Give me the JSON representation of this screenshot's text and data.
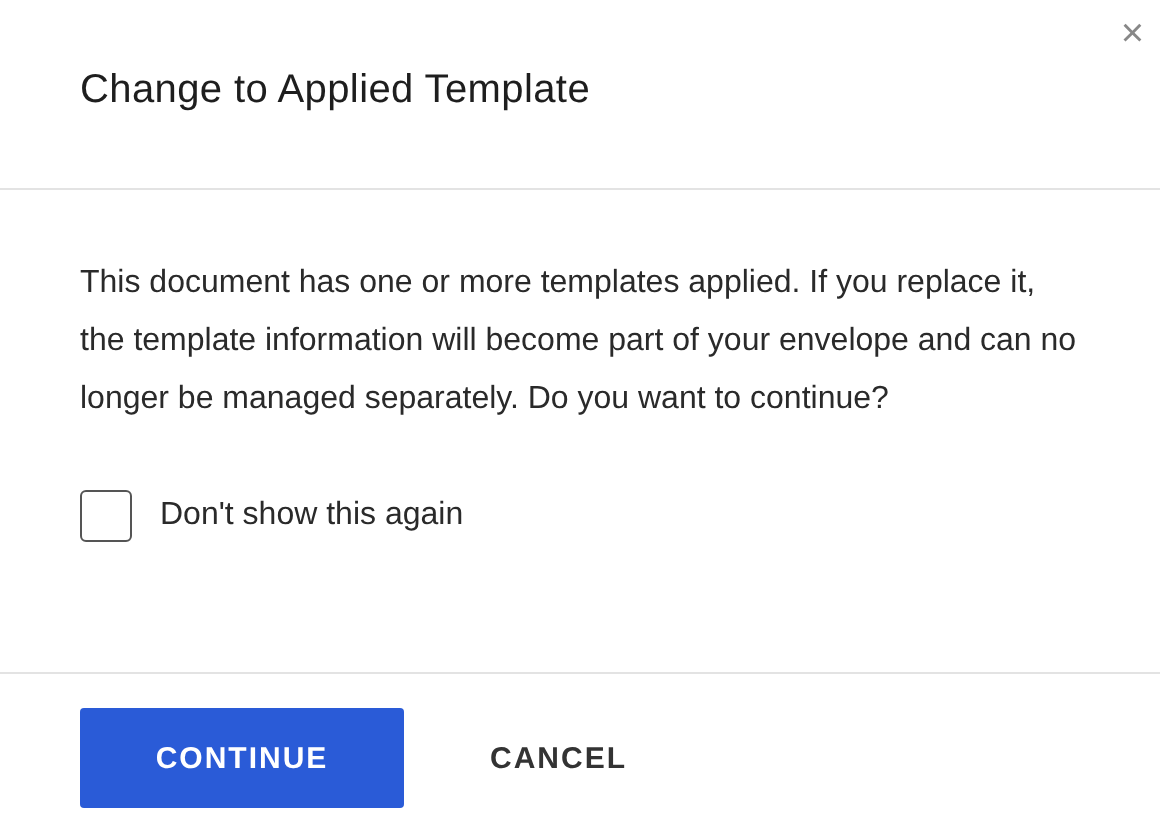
{
  "dialog": {
    "title": "Change to Applied Template",
    "close": "×",
    "message": "This document has one or more templates applied. If you replace it, the template information will become part of your envelope and can no longer be managed separately. Do you want to continue?",
    "checkbox": {
      "label": "Don't show this again",
      "checked": false
    },
    "buttons": [
      {
        "label": "CONTINUE",
        "kind": "primary"
      },
      {
        "label": "CANCEL",
        "kind": "secondary"
      }
    ]
  }
}
